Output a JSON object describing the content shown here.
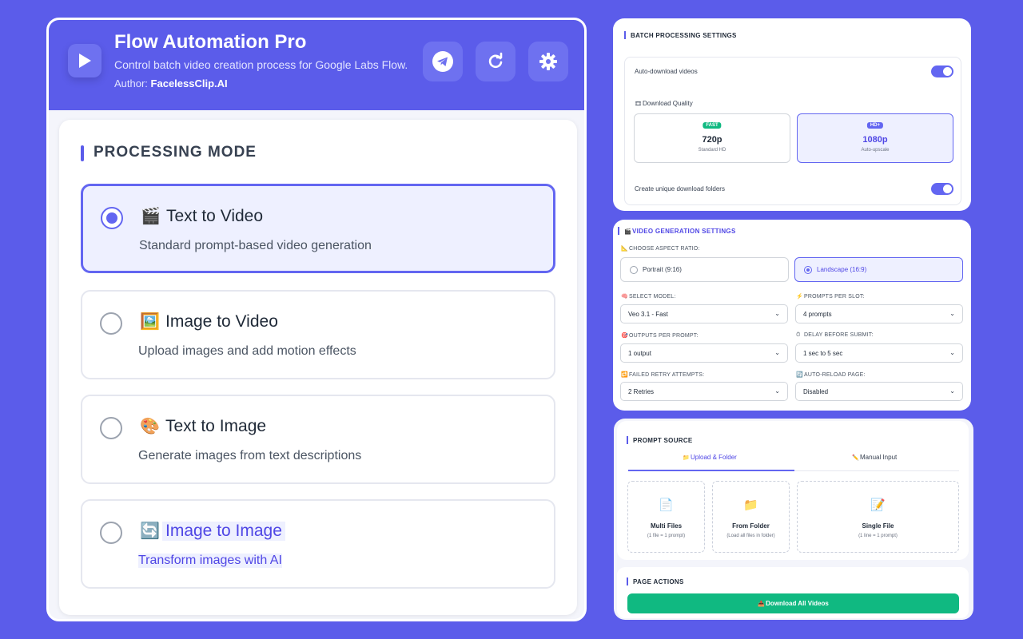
{
  "app": {
    "title": "Flow Automation Pro",
    "subtitle": "Control batch video creation process for Google Labs Flow.",
    "author_label": "Author:",
    "author_name": "FacelessClip.AI",
    "header_buttons": [
      "telegram-icon",
      "refresh-icon",
      "gear-icon"
    ]
  },
  "processing_mode": {
    "title": "PROCESSING MODE",
    "options": [
      {
        "icon": "🎬",
        "title": "Text to Video",
        "desc": "Standard prompt-based video generation",
        "selected": true
      },
      {
        "icon": "🖼️",
        "title": "Image to Video",
        "desc": "Upload images and add motion effects",
        "selected": false
      },
      {
        "icon": "🎨",
        "title": "Text to Image",
        "desc": "Generate images from text descriptions",
        "selected": false
      },
      {
        "icon": "🔄",
        "title": "Image to Image",
        "desc": "Transform images with AI",
        "selected": false
      }
    ]
  },
  "batch": {
    "title": "BATCH PROCESSING SETTINGS",
    "auto_download": "Auto-download videos",
    "quality_label": "Download Quality",
    "quality": [
      {
        "badge": "FAST",
        "value": "720p",
        "sub": "Standard HD"
      },
      {
        "badge": "HD+",
        "value": "1080p",
        "sub": "Auto-upscale"
      }
    ],
    "unique_folders": "Create unique download folders",
    "colors": {
      "fast": "#10b981",
      "hd": "#6366f1"
    }
  },
  "video": {
    "title": "VIDEO GENERATION SETTINGS",
    "aspect_label": "CHOOSE ASPECT RATIO:",
    "portrait": "Portrait (9:16)",
    "landscape": "Landscape (16:9)",
    "model_label": "SELECT MODEL:",
    "model_value": "Veo 3.1 - Fast",
    "prompts_label": "PROMPTS PER SLOT:",
    "prompts_value": "4 prompts",
    "outputs_label": "OUTPUTS PER PROMPT:",
    "outputs_value": "1 output",
    "delay_label": "DELAY BEFORE SUBMIT:",
    "delay_value": "1 sec to 5 sec",
    "retry_label": "FAILED RETRY ATTEMPTS:",
    "retry_value": "2 Retries",
    "reload_label": "AUTO-RELOAD PAGE:",
    "reload_value": "Disabled"
  },
  "prompt_source": {
    "title": "PROMPT SOURCE",
    "tab_upload": "Upload & Folder",
    "tab_manual": "Manual Input",
    "sources": [
      {
        "icon": "📄",
        "title": "Multi Files",
        "sub": "(1 file = 1 prompt)"
      },
      {
        "icon": "📁",
        "title": "From Folder",
        "sub": "(Load all files in folder)"
      },
      {
        "icon": "📝",
        "title": "Single File",
        "sub": "(1 line = 1 prompt)"
      }
    ]
  },
  "page_actions": {
    "title": "PAGE ACTIONS",
    "download_all": "Download All Videos"
  }
}
